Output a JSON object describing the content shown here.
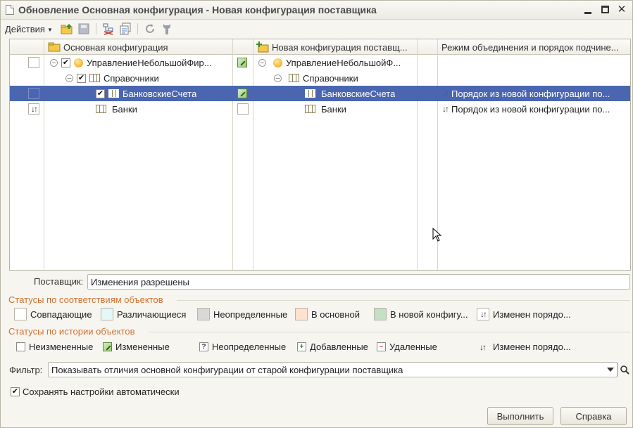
{
  "window": {
    "title": "Обновление Основная конфигурация - Новая конфигурация поставщика"
  },
  "toolbar": {
    "actions_label": "Действия",
    "icons": [
      "folder-up-icon",
      "save-icon",
      "tree-filter-icon",
      "copy-config-icon",
      "refresh-icon",
      "wrench-icon"
    ]
  },
  "grid": {
    "columns": {
      "main": "Основная конфигурация",
      "new": "Новая конфигурация поставщ...",
      "mode": "Режим объединения и порядок подчине..."
    },
    "rows": [
      {
        "main_text": "УправлениеНебольшойФир...",
        "new_text": "УправлениеНебольшойФ...",
        "mode": ""
      },
      {
        "main_text": "Справочники",
        "new_text": "Справочники",
        "mode": ""
      },
      {
        "main_text": "БанковскиеСчета",
        "new_text": "БанковскиеСчета",
        "mode": "Порядок из новой конфигурации по..."
      },
      {
        "main_text": "Банки",
        "new_text": "Банки",
        "mode": "Порядок из новой конфигурации по..."
      }
    ]
  },
  "supplier": {
    "label": "Поставщик:",
    "value": "Изменения разрешены"
  },
  "status_match": {
    "title": "Статусы по соответствиям объектов",
    "items": [
      {
        "label": "Совпадающие",
        "color": "#ffffff"
      },
      {
        "label": "Различающиеся",
        "color": "#e6f7f8"
      },
      {
        "label": "Неопределенные",
        "color": "#d9d8d6"
      },
      {
        "label": "В основной",
        "color": "#fde3cf"
      },
      {
        "label": "В новой конфигу...",
        "color": "#c4dfc4"
      },
      {
        "label": "Изменен порядо...",
        "color": "#ffffff"
      }
    ]
  },
  "status_history": {
    "title": "Статусы по истории объектов",
    "items": [
      {
        "label": "Неизмененные"
      },
      {
        "label": "Измененные"
      },
      {
        "label": "Неопределенные",
        "glyph": "?"
      },
      {
        "label": "Добавленные",
        "glyph": "+"
      },
      {
        "label": "Удаленные",
        "glyph": "–"
      },
      {
        "label": "Изменен порядо..."
      }
    ]
  },
  "filter": {
    "label": "Фильтр:",
    "value": "Показывать отличия основной конфигурации от старой конфигурации поставщика"
  },
  "autosave": {
    "label": "Сохранять настройки автоматически",
    "checked": true
  },
  "buttons": {
    "run": "Выполнить",
    "help": "Справка"
  }
}
